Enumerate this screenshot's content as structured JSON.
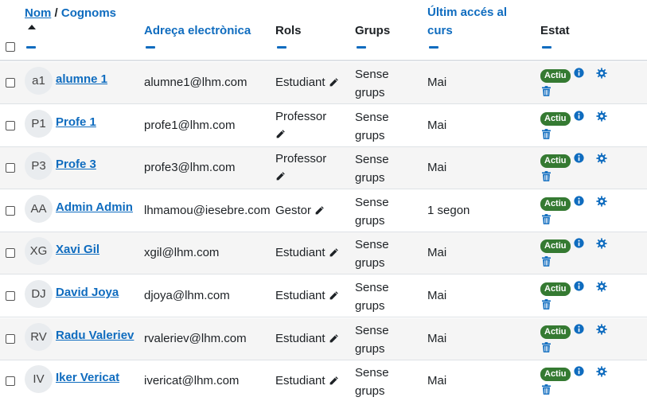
{
  "table": {
    "headers": {
      "name_first": "Nom",
      "name_sep": " / ",
      "name_last": "Cognoms",
      "email": "Adreça electrònica",
      "roles": "Rols",
      "groups": "Grups",
      "access": "Últim accés al curs",
      "status": "Estat"
    },
    "rows": [
      {
        "initials": "a1",
        "name": "alumne 1",
        "email": "alumne1@lhm.com",
        "role": "Estudiant",
        "groups_1": "Sense",
        "groups_2": "grups",
        "access": "Mai",
        "status": "Actiu"
      },
      {
        "initials": "P1",
        "name": "Profe 1",
        "email": "profe1@lhm.com",
        "role": "Professor",
        "groups_1": "Sense",
        "groups_2": "grups",
        "access": "Mai",
        "status": "Actiu"
      },
      {
        "initials": "P3",
        "name": "Profe 3",
        "email": "profe3@lhm.com",
        "role": "Professor",
        "groups_1": "Sense",
        "groups_2": "grups",
        "access": "Mai",
        "status": "Actiu"
      },
      {
        "initials": "AA",
        "name": "Admin Admin",
        "email": "lhmamou@iesebre.com",
        "role": "Gestor",
        "groups_1": "Sense",
        "groups_2": "grups",
        "access": "1 segon",
        "status": "Actiu"
      },
      {
        "initials": "XG",
        "name": "Xavi Gil",
        "email": "xgil@lhm.com",
        "role": "Estudiant",
        "groups_1": "Sense",
        "groups_2": "grups",
        "access": "Mai",
        "status": "Actiu"
      },
      {
        "initials": "DJ",
        "name": "David Joya",
        "email": "djoya@lhm.com",
        "role": "Estudiant",
        "groups_1": "Sense",
        "groups_2": "grups",
        "access": "Mai",
        "status": "Actiu"
      },
      {
        "initials": "RV",
        "name": "Radu Valeriev",
        "email": "rvaleriev@lhm.com",
        "role": "Estudiant",
        "groups_1": "Sense",
        "groups_2": "grups",
        "access": "Mai",
        "status": "Actiu"
      },
      {
        "initials": "IV",
        "name": "Iker Vericat",
        "email": "ivericat@lhm.com",
        "role": "Estudiant",
        "groups_1": "Sense",
        "groups_2": "grups",
        "access": "Mai",
        "status": "Actiu"
      }
    ]
  },
  "icons": {
    "info": "info-icon",
    "gear": "gear-icon",
    "trash": "trash-icon",
    "pencil": "pencil-icon",
    "sort": "sort-asc-icon"
  },
  "colors": {
    "link": "#0f6cbf",
    "badge_active": "#357a32",
    "row_alt": "#f5f5f5"
  }
}
